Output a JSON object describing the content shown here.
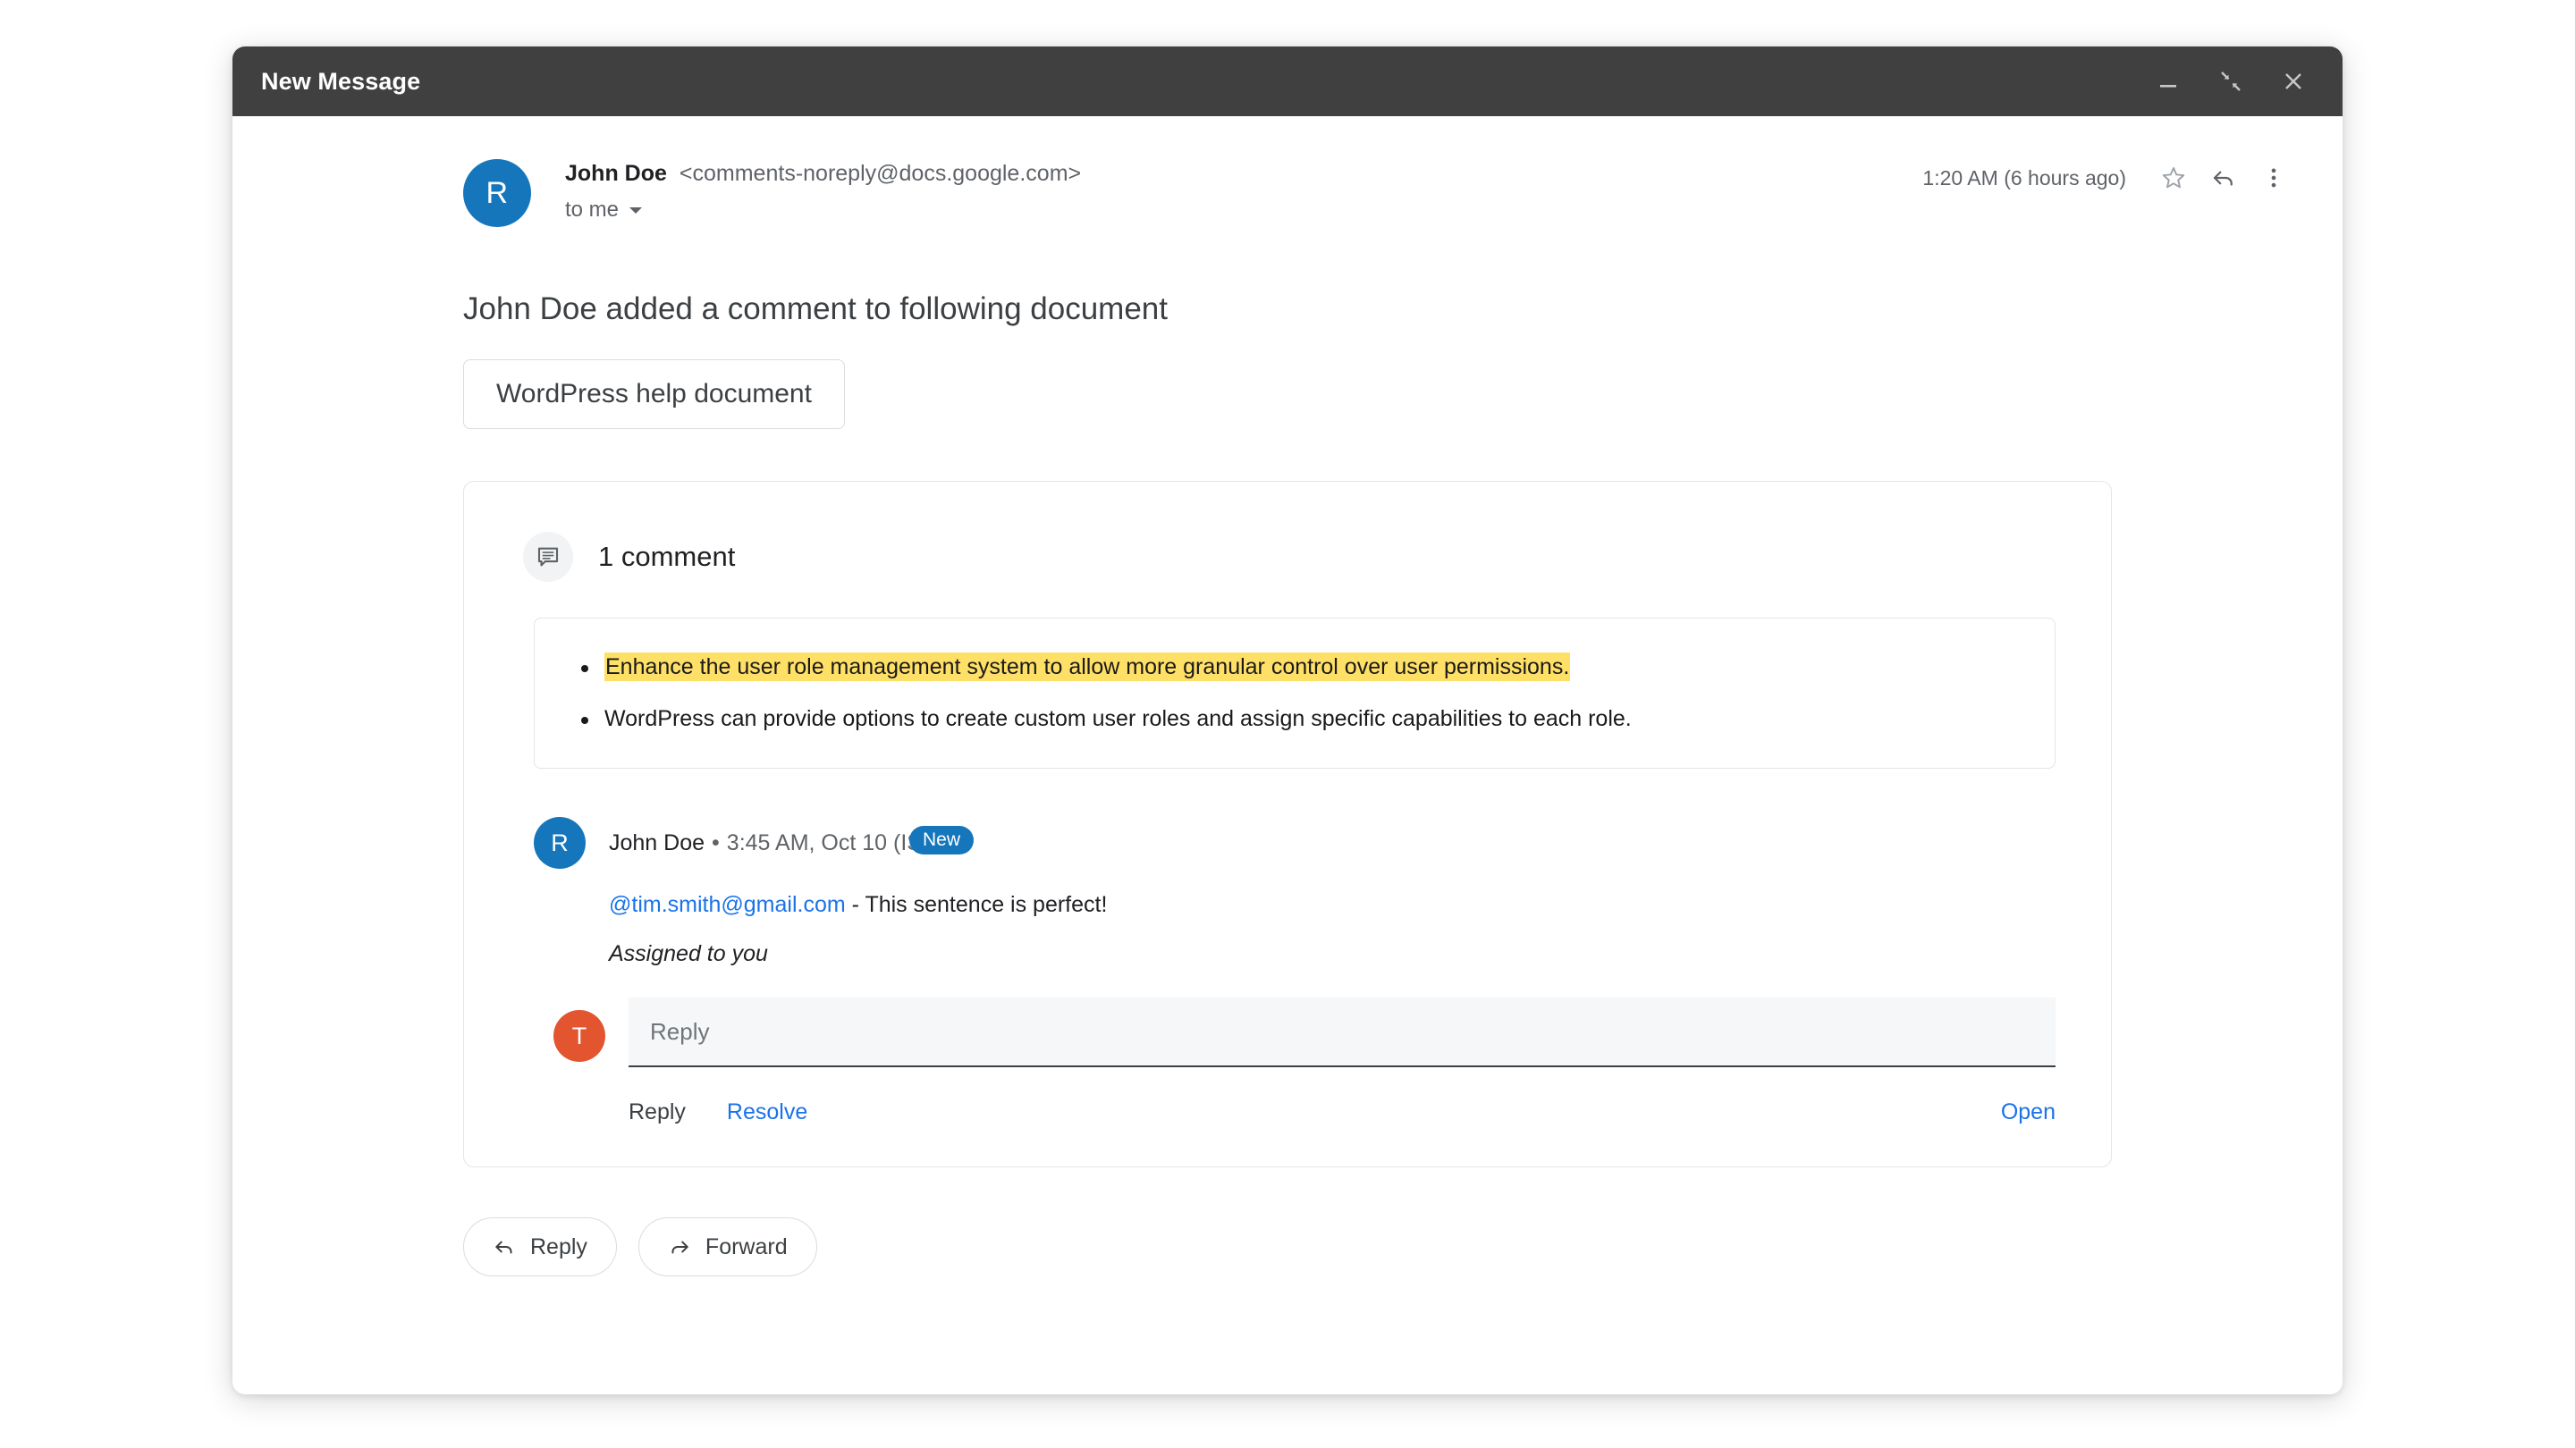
{
  "window": {
    "title": "New Message",
    "controls": [
      {
        "name": "minimize-button",
        "icon": "minimize-icon"
      },
      {
        "name": "exit-fullscreen-button",
        "icon": "exit-fullscreen-icon"
      },
      {
        "name": "close-button",
        "icon": "close-icon"
      }
    ]
  },
  "message": {
    "avatar_initial": "R",
    "avatar_color": "#1576bc",
    "sender_name": "John Doe",
    "sender_email": "<comments-noreply@docs.google.com>",
    "recipient": "to me",
    "timestamp": "1:20 AM (6 hours ago)",
    "subject": "John Doe added a comment to following document",
    "document_chip": "WordPress help document",
    "meta_icons": [
      {
        "name": "star-icon"
      },
      {
        "name": "reply-icon"
      },
      {
        "name": "more-options-icon"
      }
    ]
  },
  "comment_panel": {
    "count_icon": "comment-bubble-icon",
    "count_label": "1 comment",
    "quoted_items": [
      {
        "text": "Enhance the user role management system to allow more granular control over user permissions.",
        "highlighted": true,
        "highlight_color": "#ffe066"
      },
      {
        "text": "WordPress can provide options to create custom user roles and assign specific capabilities to each role.",
        "highlighted": false
      }
    ],
    "comment": {
      "avatar_initial": "R",
      "avatar_color": "#1576bc",
      "author": "John Doe",
      "separator": "•",
      "time": "3:45 AM, Oct 10 (IST",
      "badge": "New",
      "badge_color": "#1576bc",
      "mention": "@tim.smith@gmail.com",
      "mention_color": "#1a73e8",
      "body_rest": " - This sentence is perfect!",
      "assigned_note": "Assigned to you"
    },
    "reply": {
      "avatar_initial": "T",
      "avatar_color": "#e2552f",
      "placeholder": "Reply"
    },
    "actions": {
      "reply_label": "Reply",
      "resolve_label": "Resolve",
      "open_label": "Open"
    }
  },
  "footer": {
    "reply_button": "Reply",
    "forward_button": "Forward"
  }
}
